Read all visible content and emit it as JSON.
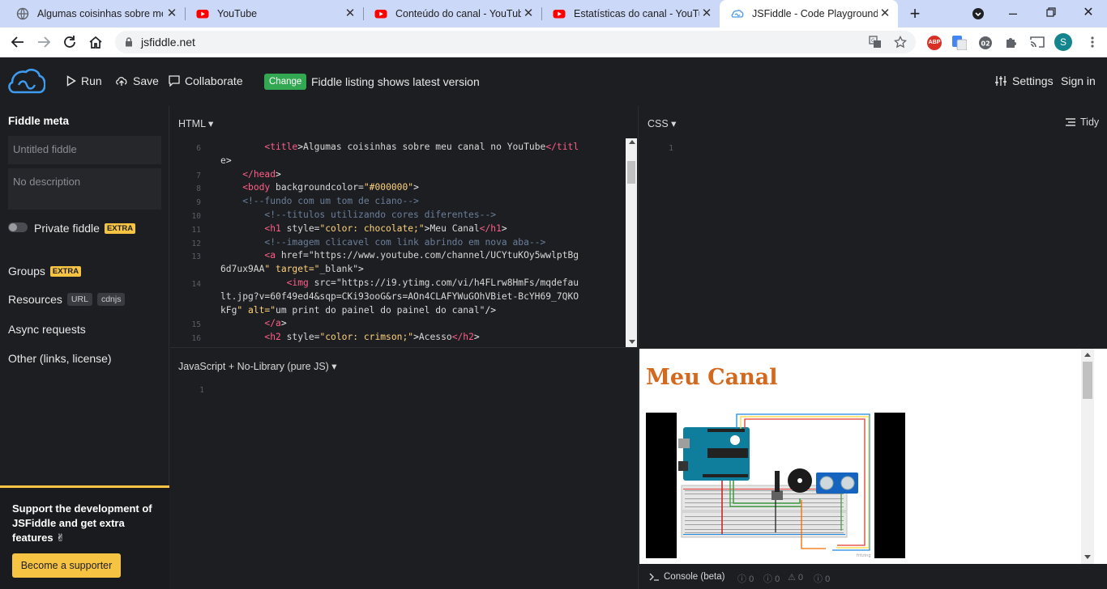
{
  "browser": {
    "tabs": [
      {
        "title": "Algumas coisinhas sobre meu canal",
        "icon": "globe-icon",
        "active": false
      },
      {
        "title": "YouTube",
        "icon": "youtube-icon",
        "active": false
      },
      {
        "title": "Conteúdo do canal - YouTube Studio",
        "icon": "youtube-icon",
        "active": false
      },
      {
        "title": "Estatísticas do canal - YouTube Studio",
        "icon": "youtube-icon",
        "active": false
      },
      {
        "title": "JSFiddle - Code Playground",
        "icon": "jsfiddle-icon",
        "active": true
      }
    ],
    "url": "jsfiddle.net",
    "profile_initial": "S"
  },
  "header": {
    "run": "Run",
    "save": "Save",
    "collaborate": "Collaborate",
    "change": "Change",
    "listing_message": "Fiddle listing shows latest version",
    "settings": "Settings",
    "sign_in": "Sign in"
  },
  "sidebar": {
    "heading": "Fiddle meta",
    "title_placeholder": "Untitled fiddle",
    "desc_placeholder": "No description",
    "private": "Private fiddle",
    "extra": "EXTRA",
    "groups": "Groups",
    "resources": "Resources",
    "url_tag": "URL",
    "cdnjs_tag": "cdnjs",
    "async": "Async requests",
    "other": "Other (links, license)",
    "support_msg": "Support the development of JSFiddle and get extra features ✌",
    "support_btn": "Become a supporter"
  },
  "panels": {
    "html_label": "HTML ▾",
    "css_label": "CSS ▾",
    "tidy": "Tidy",
    "js_label": "JavaScript + No-Library (pure JS) ▾",
    "console_label": "Console (beta)",
    "console_counts": [
      "0",
      "0",
      "0",
      "0"
    ]
  },
  "html_code": {
    "line_numbers": [
      "6",
      "",
      "7",
      "8",
      "9",
      "10",
      "11",
      "12",
      "13",
      "",
      "14",
      "",
      "",
      "15",
      "16"
    ],
    "lines": [
      "        <title>Algumas coisinhas sobre meu canal no YouTube</titl",
      "e>",
      "    </head>",
      "    <body backgroundcolor=\"#000000\">",
      "    <!--fundo com um tom de ciano-->",
      "        <!--titulos utilizando cores diferentes-->",
      "        <h1 style=\"color: chocolate;\">Meu Canal</h1>",
      "        <!--imagem clicavel com link abrindo em nova aba-->",
      "        <a href=\"https://www.youtube.com/channel/UCYtuKOy5wwlptBg",
      "6d7ux9AA\" target=\"_blank\">",
      "            <img src=\"https://i9.ytimg.com/vi/h4FLrw8HmFs/mqdefau",
      "lt.jpg?v=60f49ed4&sqp=CKi93ooG&rs=AOn4CLAFYWuGOhVBiet-BcYH69_7QKO",
      "kFg\" alt=\"um print do painel do painel do canal\"/>",
      "        </a>",
      "        <h2 style=\"color: crimson;\">Acesso</h2>"
    ]
  },
  "css_code": {
    "line_numbers": [
      "1"
    ]
  },
  "js_code": {
    "line_numbers": [
      "1"
    ]
  },
  "result": {
    "heading": "Meu Canal",
    "watermark": "fritzing"
  }
}
